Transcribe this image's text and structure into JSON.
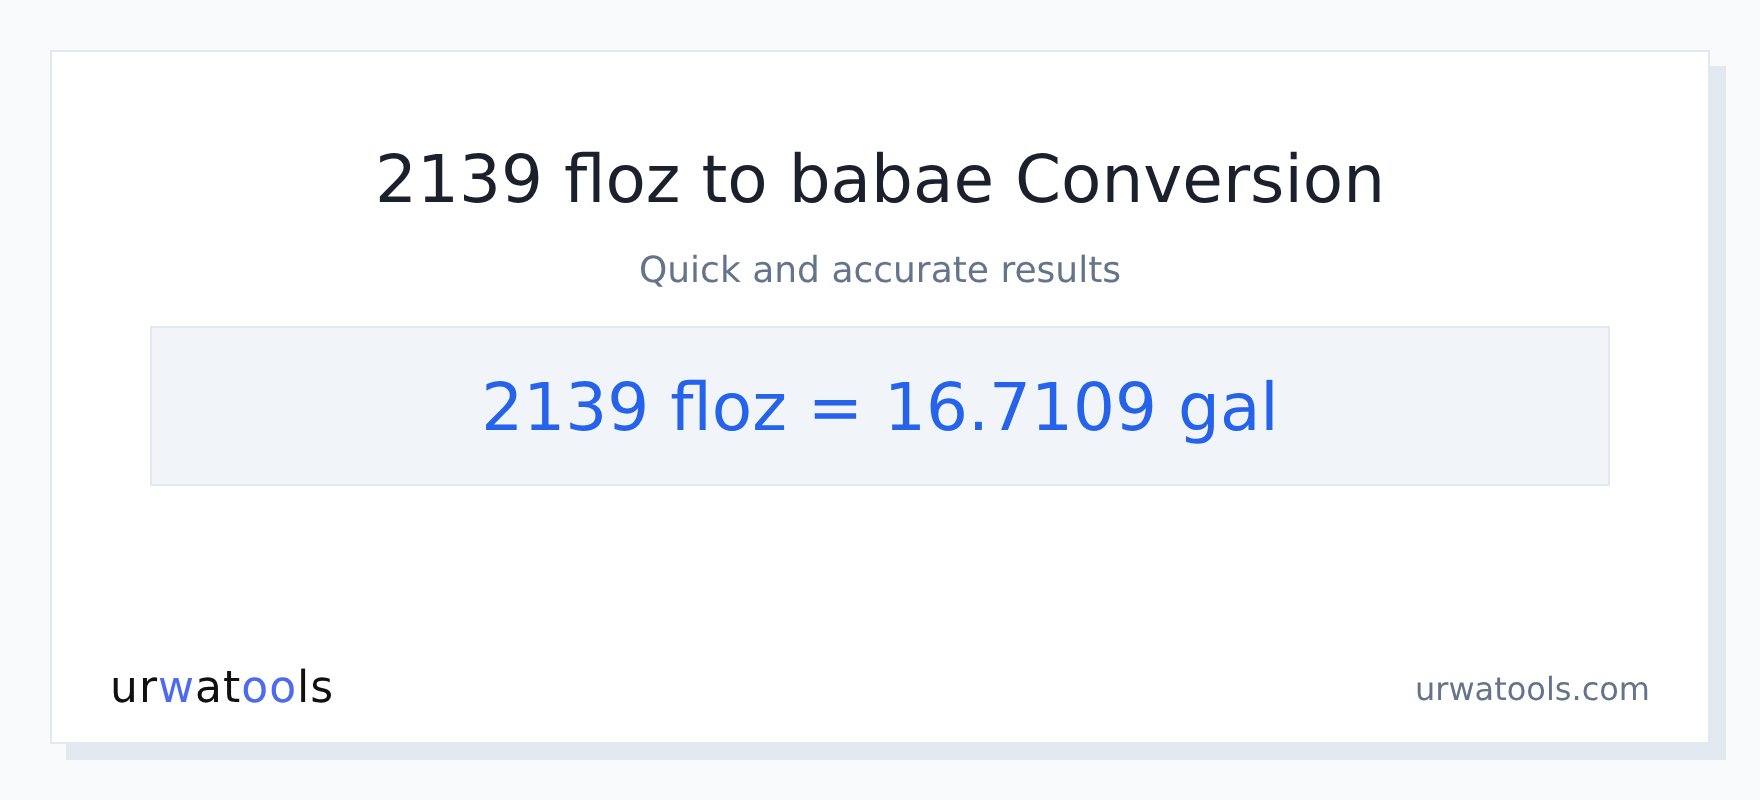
{
  "title": "2139 floz to babae Conversion",
  "subtitle": "Quick and accurate results",
  "result": "2139 floz = 16.7109 gal",
  "logo": [
    {
      "text": "ur",
      "accent": false
    },
    {
      "text": "w",
      "accent": true
    },
    {
      "text": "at",
      "accent": false
    },
    {
      "text": "oo",
      "accent": true
    },
    {
      "text": "ls",
      "accent": false
    }
  ],
  "site": "urwatools.com"
}
